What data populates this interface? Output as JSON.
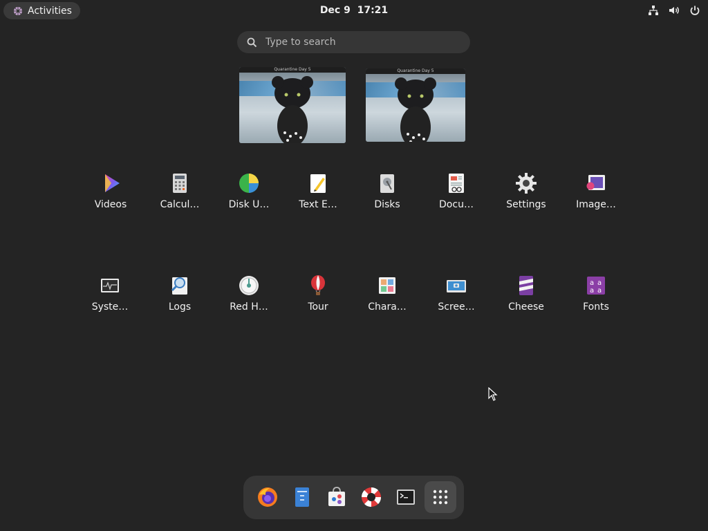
{
  "topbar": {
    "activities_label": "Activities",
    "date": "Dec 9",
    "time": "17:21",
    "tray_icons": [
      "network-icon",
      "volume-icon",
      "power-icon"
    ]
  },
  "search": {
    "placeholder": "Type to search"
  },
  "workspaces": [
    {
      "title": "Quarantine Day 5"
    },
    {
      "title": "Quarantine Day 5"
    }
  ],
  "apps": [
    {
      "label": "Videos",
      "icon": "videos-icon"
    },
    {
      "label": "Calcul…",
      "icon": "calculator-icon"
    },
    {
      "label": "Disk U…",
      "icon": "disk-usage-icon"
    },
    {
      "label": "Text E…",
      "icon": "text-editor-icon"
    },
    {
      "label": "Disks",
      "icon": "disks-icon"
    },
    {
      "label": "Docu…",
      "icon": "document-viewer-icon"
    },
    {
      "label": "Settings",
      "icon": "settings-icon"
    },
    {
      "label": "Image…",
      "icon": "image-viewer-icon"
    },
    {
      "label": "Syste…",
      "icon": "system-monitor-icon"
    },
    {
      "label": "Logs",
      "icon": "logs-icon"
    },
    {
      "label": "Red H…",
      "icon": "red-hat-icon"
    },
    {
      "label": "Tour",
      "icon": "tour-icon"
    },
    {
      "label": "Chara…",
      "icon": "characters-icon"
    },
    {
      "label": "Scree…",
      "icon": "screenshot-icon"
    },
    {
      "label": "Cheese",
      "icon": "cheese-icon"
    },
    {
      "label": "Fonts",
      "icon": "fonts-icon"
    }
  ],
  "dock": [
    {
      "icon": "firefox-icon"
    },
    {
      "icon": "files-icon"
    },
    {
      "icon": "software-icon"
    },
    {
      "icon": "help-icon"
    },
    {
      "icon": "terminal-icon"
    },
    {
      "icon": "show-apps-icon",
      "active": true
    }
  ],
  "colors": {
    "background": "#242424",
    "panel": "#363636",
    "text": "#ffffff"
  }
}
